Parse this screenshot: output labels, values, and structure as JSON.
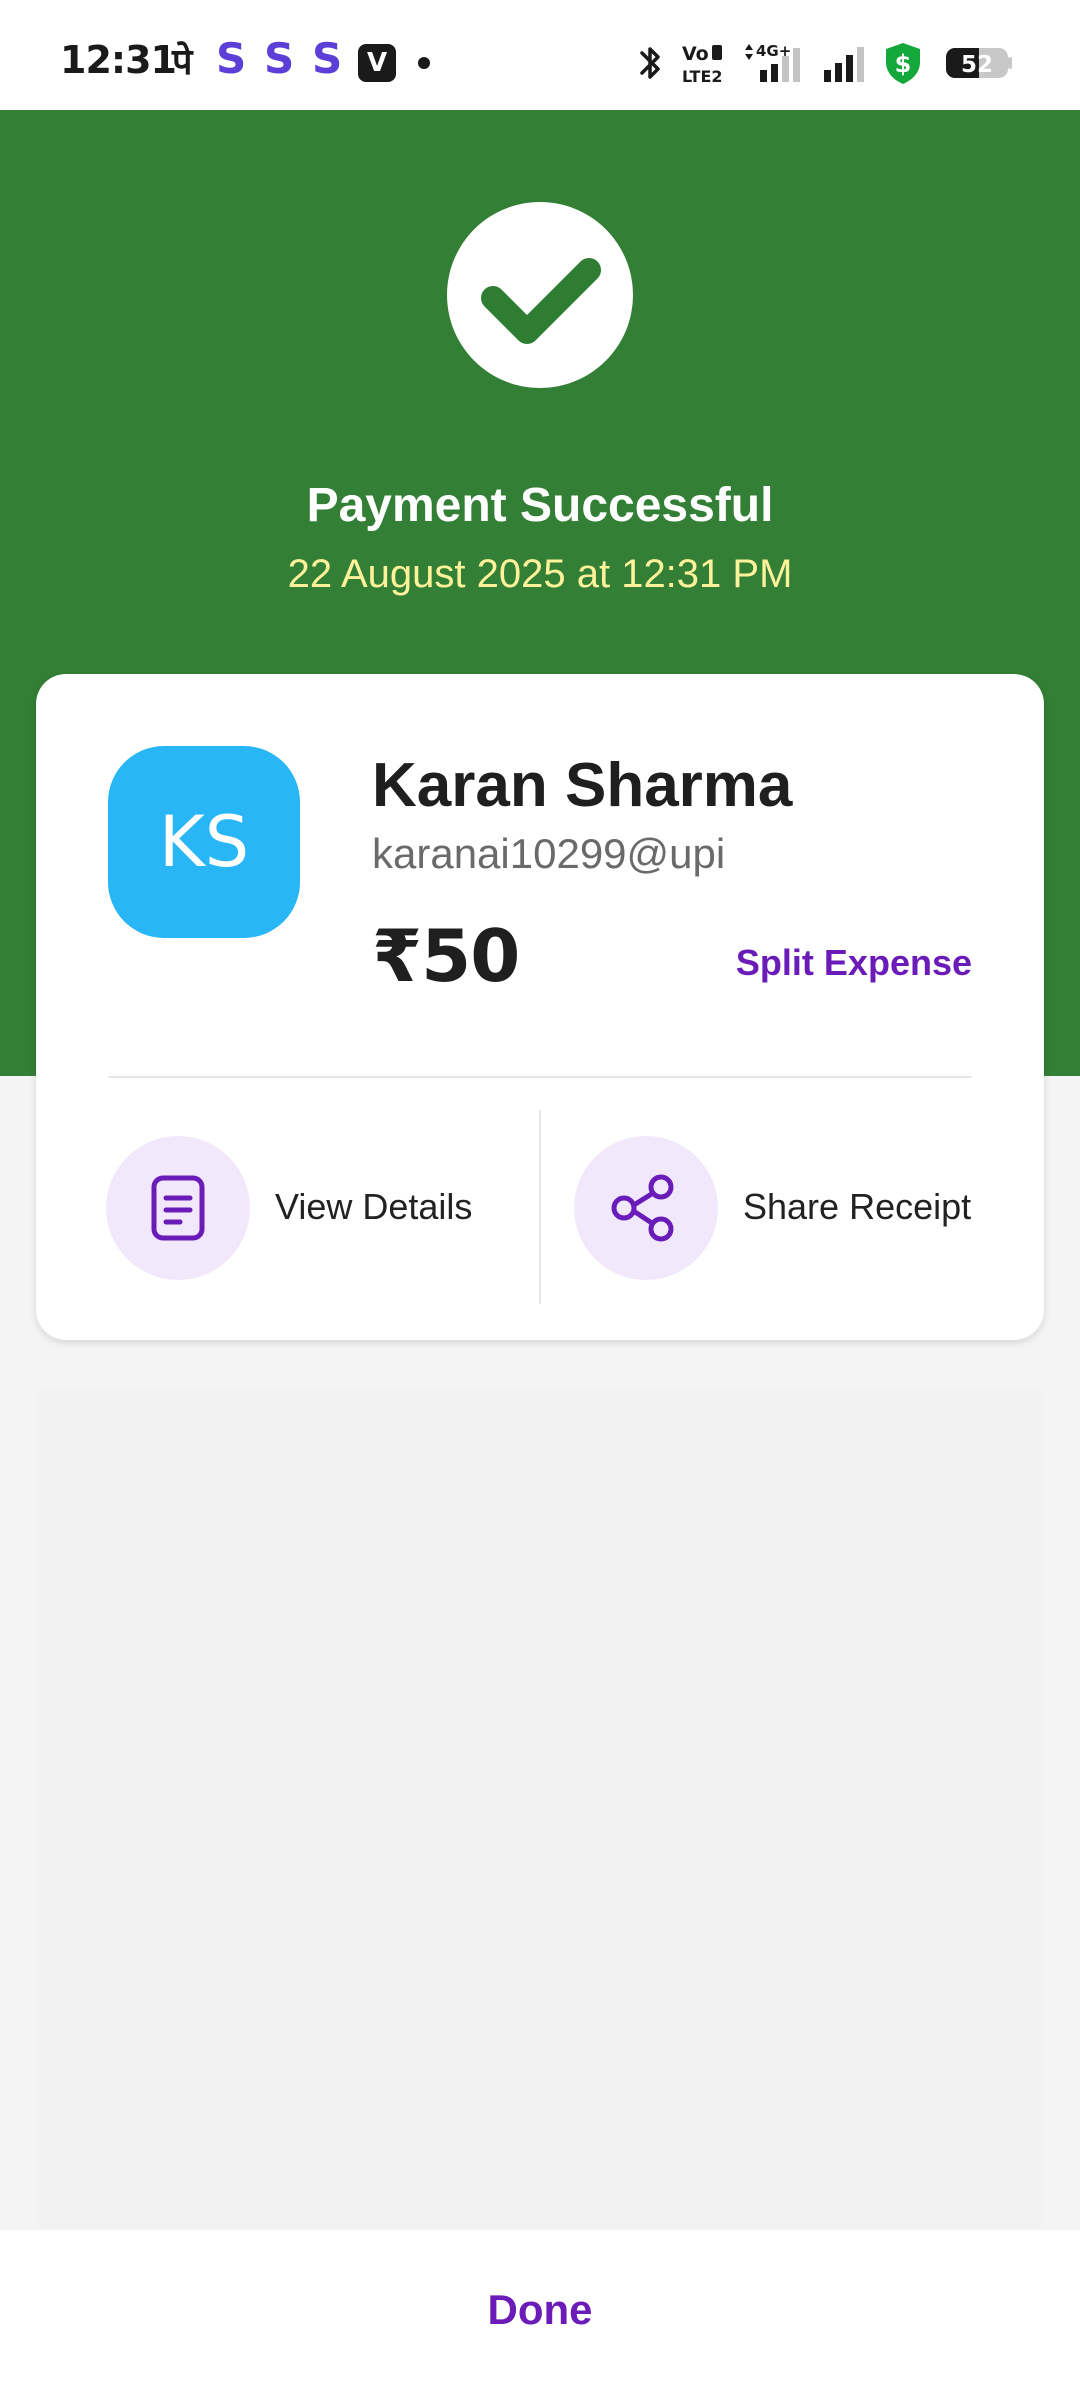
{
  "status_bar": {
    "time": "12:31",
    "notification_pe": "पे",
    "notification_s1": "S",
    "notification_s2": "S",
    "notification_s3": "S",
    "notification_v": "V",
    "network_label_1": "Vo",
    "network_label_2": "LTE2",
    "network_4g": "4G+",
    "battery_level": "52",
    "icons": [
      "bluetooth-icon",
      "volte-icon",
      "signal-4g-icon",
      "signal-icon",
      "shield-dollar-icon",
      "battery-icon"
    ]
  },
  "header": {
    "status_icon": "check-icon",
    "title": "Payment Successful",
    "datetime": "22 August 2025 at 12:31 PM",
    "background_color": "#327f35"
  },
  "payee": {
    "initials": "KS",
    "name": "Karan Sharma",
    "upi_id": "karanai10299@upi",
    "amount": "₹50",
    "split_label": "Split Expense",
    "avatar_color": "#29b6f6"
  },
  "actions": {
    "view_details_label": "View Details",
    "view_details_icon": "document-icon",
    "share_receipt_label": "Share Receipt",
    "share_receipt_icon": "share-icon"
  },
  "footer": {
    "done_label": "Done",
    "accent_color": "#6a1bb8"
  }
}
